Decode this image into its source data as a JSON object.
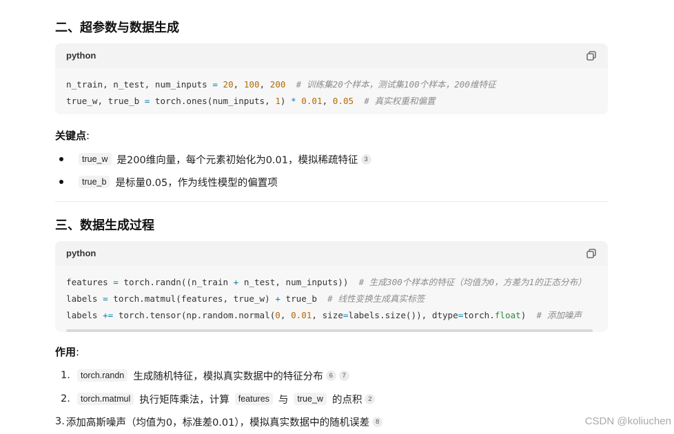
{
  "section2": {
    "title": "二、超参数与数据生成",
    "code": {
      "lang": "python",
      "lines": [
        [
          {
            "t": "n_train, n_test, num_inputs ",
            "c": ""
          },
          {
            "t": "=",
            "c": "op"
          },
          {
            "t": " ",
            "c": ""
          },
          {
            "t": "20",
            "c": "num"
          },
          {
            "t": ", ",
            "c": ""
          },
          {
            "t": "100",
            "c": "num"
          },
          {
            "t": ", ",
            "c": ""
          },
          {
            "t": "200",
            "c": "num"
          },
          {
            "t": "  # 训练集20个样本，测试集100个样本，200维特征",
            "c": "cm"
          }
        ],
        [
          {
            "t": "true_w, true_b ",
            "c": ""
          },
          {
            "t": "=",
            "c": "op"
          },
          {
            "t": " torch.ones(num_inputs, ",
            "c": ""
          },
          {
            "t": "1",
            "c": "num"
          },
          {
            "t": ") ",
            "c": ""
          },
          {
            "t": "*",
            "c": "op"
          },
          {
            "t": " ",
            "c": ""
          },
          {
            "t": "0.01",
            "c": "num"
          },
          {
            "t": ", ",
            "c": ""
          },
          {
            "t": "0.05",
            "c": "num"
          },
          {
            "t": "  # 真实权重和偏置",
            "c": "cm"
          }
        ]
      ]
    },
    "keypoints_label": "关键点",
    "colon": ":",
    "bullets": [
      {
        "chip": "true_w",
        "text": "是200维向量，每个元素初始化为0.01，模拟稀疏特征",
        "cites": [
          "3"
        ]
      },
      {
        "chip": "true_b",
        "text": "是标量0.05，作为线性模型的偏置项",
        "cites": []
      }
    ]
  },
  "section3": {
    "title": "三、数据生成过程",
    "code": {
      "lang": "python",
      "lines": [
        [
          {
            "t": "features ",
            "c": ""
          },
          {
            "t": "=",
            "c": "op"
          },
          {
            "t": " torch.randn((n_train ",
            "c": ""
          },
          {
            "t": "+",
            "c": "op"
          },
          {
            "t": " n_test, num_inputs))  ",
            "c": ""
          },
          {
            "t": "# 生成300个样本的特征（均值为0，方差为1的正态分布）",
            "c": "cm"
          }
        ],
        [
          {
            "t": "labels ",
            "c": ""
          },
          {
            "t": "=",
            "c": "op"
          },
          {
            "t": " torch.matmul(features, true_w) ",
            "c": ""
          },
          {
            "t": "+",
            "c": "op"
          },
          {
            "t": " true_b  ",
            "c": ""
          },
          {
            "t": "# 线性变换生成真实标签",
            "c": "cm"
          }
        ],
        [
          {
            "t": "labels ",
            "c": ""
          },
          {
            "t": "+=",
            "c": "op"
          },
          {
            "t": " torch.tensor(np.random.normal(",
            "c": ""
          },
          {
            "t": "0",
            "c": "num"
          },
          {
            "t": ", ",
            "c": ""
          },
          {
            "t": "0.01",
            "c": "num"
          },
          {
            "t": ", size",
            "c": ""
          },
          {
            "t": "=",
            "c": "op"
          },
          {
            "t": "labels.size()), dtype",
            "c": ""
          },
          {
            "t": "=",
            "c": "op"
          },
          {
            "t": "torch.",
            "c": ""
          },
          {
            "t": "float",
            "c": "kw"
          },
          {
            "t": ")  ",
            "c": ""
          },
          {
            "t": "# 添加噪声",
            "c": "cm"
          }
        ]
      ]
    },
    "effect_label": "作用",
    "colon": ":",
    "items": [
      {
        "marker": "1.",
        "parts": [
          {
            "chip": "torch.randn"
          },
          {
            "text": "生成随机特征，模拟真实数据中的特征分布"
          }
        ],
        "cites": [
          "6",
          "7"
        ]
      },
      {
        "marker": "2.",
        "parts": [
          {
            "chip": "torch.matmul"
          },
          {
            "text": "执行矩阵乘法，计算"
          },
          {
            "chip": "features"
          },
          {
            "text": "与"
          },
          {
            "chip": "true_w"
          },
          {
            "text": "的点积"
          }
        ],
        "cites": [
          "2"
        ]
      },
      {
        "marker": "3.",
        "parts": [
          {
            "text": "添加高斯噪声（均值为0，标准差0.01），模拟真实数据中的随机误差"
          }
        ],
        "cites": [
          "8"
        ]
      }
    ]
  },
  "watermark": "CSDN @koliuchen",
  "icons": {
    "copy": "copy-icon"
  },
  "colors": {
    "operator": "#0b7ea8",
    "number": "#b36a00",
    "comment": "#8c8c8c",
    "keyword": "#2e8b3a"
  }
}
